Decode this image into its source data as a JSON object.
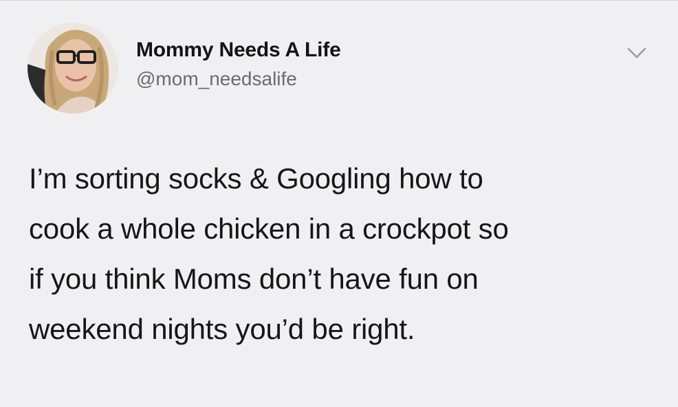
{
  "author": {
    "display_name": "Mommy Needs A Life",
    "handle": "@mom_needsalife",
    "avatar_icon": "profile-photo"
  },
  "menu_icon": "chevron-down-icon",
  "tweet": {
    "lines": [
      "I’m sorting socks & Googling how to",
      "cook a whole chicken in a crockpot so",
      "if you think Moms don’t have fun on",
      "weekend nights you’d be right."
    ]
  },
  "colors": {
    "background": "#f0f0f2",
    "text": "#161616",
    "secondary_text": "#6b6b70",
    "icon": "#9a9aa0"
  }
}
